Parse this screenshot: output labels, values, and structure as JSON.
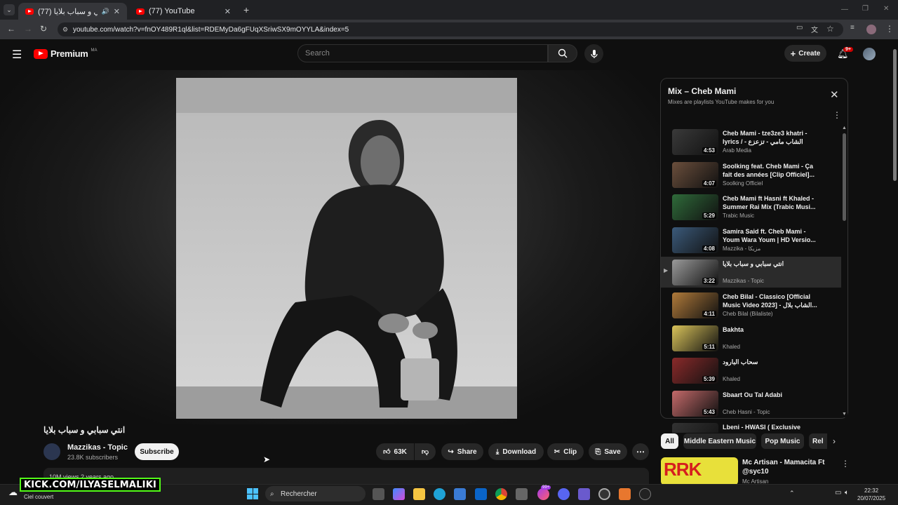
{
  "browser": {
    "tabs": [
      {
        "title": "انتي سبابي و سباب بلايا (77)",
        "active": true
      },
      {
        "title": "(77) YouTube",
        "active": false
      }
    ],
    "new_tab": "+",
    "url": "youtube.com/watch?v=fnOY489R1ql&list=RDEMyDa6gFUqXSriwSX9mOYYLA&index=5"
  },
  "header": {
    "logo_text": "Premium",
    "region": "MA",
    "search_placeholder": "Search",
    "create_label": "Create",
    "notif_badge": "9+"
  },
  "video": {
    "title": "انتي سبابي و سباب بلايا",
    "channel": "Mazzikas - Topic",
    "subscribers": "23.8K subscribers",
    "subscribe_label": "Subscribe",
    "likes": "63K",
    "share_label": "Share",
    "download_label": "Download",
    "clip_label": "Clip",
    "save_label": "Save",
    "description_stub": "10M views  2 years ago"
  },
  "playlist": {
    "title": "Mix – Cheb Mami",
    "subtitle": "Mixes are playlists YouTube makes for you",
    "items": [
      {
        "title": "Cheb Mami - tze3ze3 khatri - lyrics / - الشاب مامي - تزعزع خاطري",
        "channel": "Arab Media",
        "duration": "4:53",
        "color": "#3a3a3a"
      },
      {
        "title": "Soolking feat. Cheb Mami - Ça fait des années [Clip Officiel]...",
        "channel": "Soolking Officiel",
        "duration": "4:07",
        "color": "#6b4f3c"
      },
      {
        "title": "Cheb Mami ft Hasni ft Khaled - Summer Rai Mix (Trabic Musi...",
        "channel": "Trabic Music",
        "duration": "5:29",
        "color": "#2f6b3a"
      },
      {
        "title": "Samira Said ft. Cheb Mami - Youm Wara Youm | HD Versio...",
        "channel": "Mazzika - مزيكا",
        "duration": "4:08",
        "color": "#3b5a7a"
      },
      {
        "title": "انتي سبابي و سباب بلايا",
        "channel": "Mazzikas - Topic",
        "duration": "3:22",
        "color": "#9a9a9a",
        "current": true
      },
      {
        "title": "Cheb Bilal - Classico [Official Music Video 2023] - الشاب بلال...",
        "channel": "Cheb Bilal (Bilaliste)",
        "duration": "4:11",
        "color": "#b07a3a"
      },
      {
        "title": "Bakhta",
        "channel": "Khaled",
        "duration": "5:11",
        "color": "#d9c35a"
      },
      {
        "title": "سحاب البارود",
        "channel": "Khaled",
        "duration": "5:39",
        "color": "#8a2a2a"
      },
      {
        "title": "Sbaart Ou Tal Adabi",
        "channel": "Cheb Hasni - Topic",
        "duration": "5:43",
        "color": "#c46a6a"
      },
      {
        "title": "Lbeni - HWASI ( Exclusive",
        "channel": "",
        "duration": "",
        "color": "#333"
      }
    ]
  },
  "chips": [
    "All",
    "Middle Eastern Music",
    "Pop Music",
    "Rel"
  ],
  "recommendation": {
    "title": "Mc Artisan - Mamacita Ft @syc10",
    "channel": "Mc Artisan",
    "thumb_text": "RRK"
  },
  "overlay": {
    "kick_text": "KICK.COM/ILYASELMALIKI"
  },
  "taskbar": {
    "search_placeholder": "Rechercher",
    "weather": "Ciel couvert",
    "time": "22:32",
    "date": "20/07/2025",
    "badge": "99+"
  }
}
